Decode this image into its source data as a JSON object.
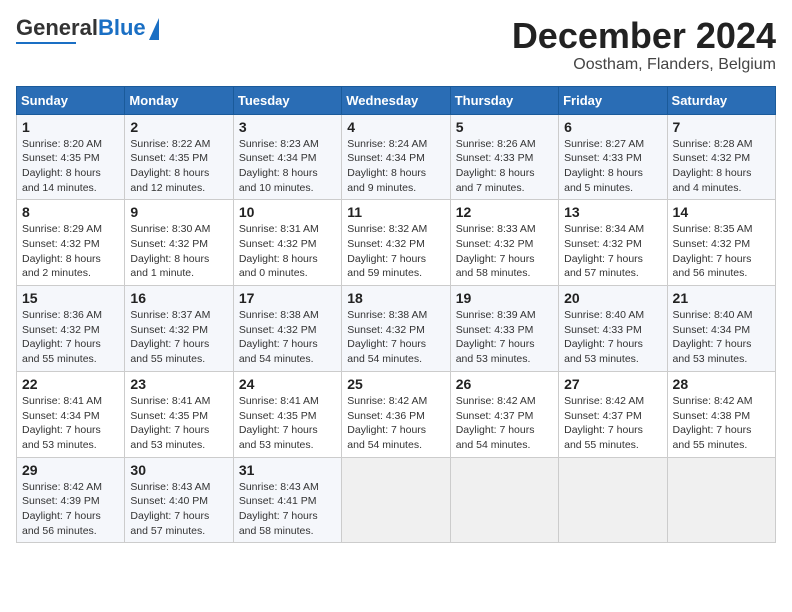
{
  "header": {
    "logo_line1": "General",
    "logo_line2": "Blue",
    "month_title": "December 2024",
    "location": "Oostham, Flanders, Belgium"
  },
  "weekdays": [
    "Sunday",
    "Monday",
    "Tuesday",
    "Wednesday",
    "Thursday",
    "Friday",
    "Saturday"
  ],
  "weeks": [
    [
      {
        "day": "1",
        "rise": "Sunrise: 8:20 AM",
        "set": "Sunset: 4:35 PM",
        "light": "Daylight: 8 hours and 14 minutes."
      },
      {
        "day": "2",
        "rise": "Sunrise: 8:22 AM",
        "set": "Sunset: 4:35 PM",
        "light": "Daylight: 8 hours and 12 minutes."
      },
      {
        "day": "3",
        "rise": "Sunrise: 8:23 AM",
        "set": "Sunset: 4:34 PM",
        "light": "Daylight: 8 hours and 10 minutes."
      },
      {
        "day": "4",
        "rise": "Sunrise: 8:24 AM",
        "set": "Sunset: 4:34 PM",
        "light": "Daylight: 8 hours and 9 minutes."
      },
      {
        "day": "5",
        "rise": "Sunrise: 8:26 AM",
        "set": "Sunset: 4:33 PM",
        "light": "Daylight: 8 hours and 7 minutes."
      },
      {
        "day": "6",
        "rise": "Sunrise: 8:27 AM",
        "set": "Sunset: 4:33 PM",
        "light": "Daylight: 8 hours and 5 minutes."
      },
      {
        "day": "7",
        "rise": "Sunrise: 8:28 AM",
        "set": "Sunset: 4:32 PM",
        "light": "Daylight: 8 hours and 4 minutes."
      }
    ],
    [
      {
        "day": "8",
        "rise": "Sunrise: 8:29 AM",
        "set": "Sunset: 4:32 PM",
        "light": "Daylight: 8 hours and 2 minutes."
      },
      {
        "day": "9",
        "rise": "Sunrise: 8:30 AM",
        "set": "Sunset: 4:32 PM",
        "light": "Daylight: 8 hours and 1 minute."
      },
      {
        "day": "10",
        "rise": "Sunrise: 8:31 AM",
        "set": "Sunset: 4:32 PM",
        "light": "Daylight: 8 hours and 0 minutes."
      },
      {
        "day": "11",
        "rise": "Sunrise: 8:32 AM",
        "set": "Sunset: 4:32 PM",
        "light": "Daylight: 7 hours and 59 minutes."
      },
      {
        "day": "12",
        "rise": "Sunrise: 8:33 AM",
        "set": "Sunset: 4:32 PM",
        "light": "Daylight: 7 hours and 58 minutes."
      },
      {
        "day": "13",
        "rise": "Sunrise: 8:34 AM",
        "set": "Sunset: 4:32 PM",
        "light": "Daylight: 7 hours and 57 minutes."
      },
      {
        "day": "14",
        "rise": "Sunrise: 8:35 AM",
        "set": "Sunset: 4:32 PM",
        "light": "Daylight: 7 hours and 56 minutes."
      }
    ],
    [
      {
        "day": "15",
        "rise": "Sunrise: 8:36 AM",
        "set": "Sunset: 4:32 PM",
        "light": "Daylight: 7 hours and 55 minutes."
      },
      {
        "day": "16",
        "rise": "Sunrise: 8:37 AM",
        "set": "Sunset: 4:32 PM",
        "light": "Daylight: 7 hours and 55 minutes."
      },
      {
        "day": "17",
        "rise": "Sunrise: 8:38 AM",
        "set": "Sunset: 4:32 PM",
        "light": "Daylight: 7 hours and 54 minutes."
      },
      {
        "day": "18",
        "rise": "Sunrise: 8:38 AM",
        "set": "Sunset: 4:32 PM",
        "light": "Daylight: 7 hours and 54 minutes."
      },
      {
        "day": "19",
        "rise": "Sunrise: 8:39 AM",
        "set": "Sunset: 4:33 PM",
        "light": "Daylight: 7 hours and 53 minutes."
      },
      {
        "day": "20",
        "rise": "Sunrise: 8:40 AM",
        "set": "Sunset: 4:33 PM",
        "light": "Daylight: 7 hours and 53 minutes."
      },
      {
        "day": "21",
        "rise": "Sunrise: 8:40 AM",
        "set": "Sunset: 4:34 PM",
        "light": "Daylight: 7 hours and 53 minutes."
      }
    ],
    [
      {
        "day": "22",
        "rise": "Sunrise: 8:41 AM",
        "set": "Sunset: 4:34 PM",
        "light": "Daylight: 7 hours and 53 minutes."
      },
      {
        "day": "23",
        "rise": "Sunrise: 8:41 AM",
        "set": "Sunset: 4:35 PM",
        "light": "Daylight: 7 hours and 53 minutes."
      },
      {
        "day": "24",
        "rise": "Sunrise: 8:41 AM",
        "set": "Sunset: 4:35 PM",
        "light": "Daylight: 7 hours and 53 minutes."
      },
      {
        "day": "25",
        "rise": "Sunrise: 8:42 AM",
        "set": "Sunset: 4:36 PM",
        "light": "Daylight: 7 hours and 54 minutes."
      },
      {
        "day": "26",
        "rise": "Sunrise: 8:42 AM",
        "set": "Sunset: 4:37 PM",
        "light": "Daylight: 7 hours and 54 minutes."
      },
      {
        "day": "27",
        "rise": "Sunrise: 8:42 AM",
        "set": "Sunset: 4:37 PM",
        "light": "Daylight: 7 hours and 55 minutes."
      },
      {
        "day": "28",
        "rise": "Sunrise: 8:42 AM",
        "set": "Sunset: 4:38 PM",
        "light": "Daylight: 7 hours and 55 minutes."
      }
    ],
    [
      {
        "day": "29",
        "rise": "Sunrise: 8:42 AM",
        "set": "Sunset: 4:39 PM",
        "light": "Daylight: 7 hours and 56 minutes."
      },
      {
        "day": "30",
        "rise": "Sunrise: 8:43 AM",
        "set": "Sunset: 4:40 PM",
        "light": "Daylight: 7 hours and 57 minutes."
      },
      {
        "day": "31",
        "rise": "Sunrise: 8:43 AM",
        "set": "Sunset: 4:41 PM",
        "light": "Daylight: 7 hours and 58 minutes."
      },
      null,
      null,
      null,
      null
    ]
  ]
}
